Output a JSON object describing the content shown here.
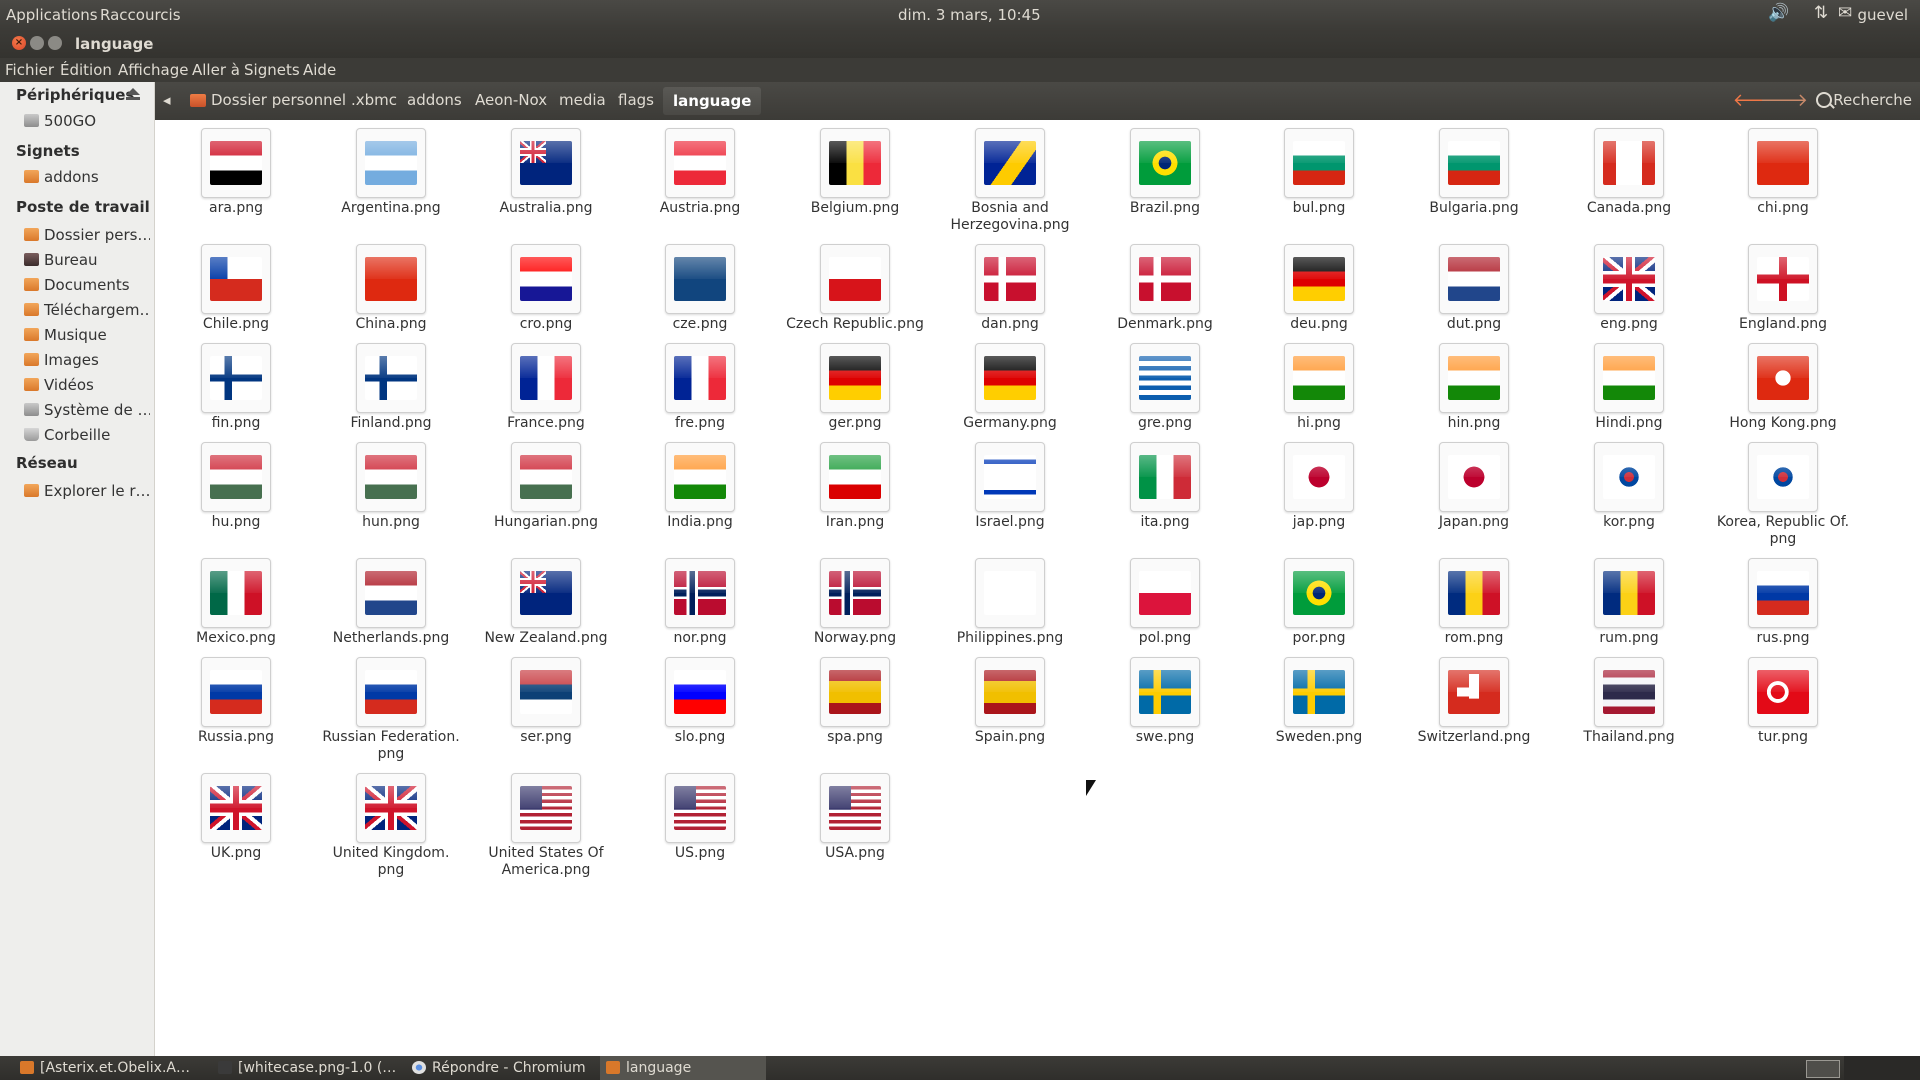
{
  "top_panel": {
    "apps": "Applications",
    "places": "Raccourcis",
    "clock": "dim.  3 mars, 10:45",
    "user": "guevel"
  },
  "window": {
    "title": "language"
  },
  "menu": [
    "Fichier",
    "Édition",
    "Affichage",
    "Aller à",
    "Signets",
    "Aide"
  ],
  "sidebar": {
    "devices_title": "Périphériques",
    "devices": [
      {
        "label": "500GO",
        "icon": "drive-icon"
      }
    ],
    "bookmarks_title": "Signets",
    "bookmarks": [
      {
        "label": "addons",
        "icon": "folder-icon"
      }
    ],
    "computer_title": "Poste de travail",
    "computer": [
      {
        "label": "Dossier pers…",
        "icon": "home-folder-icon"
      },
      {
        "label": "Bureau",
        "icon": "desktop-icon"
      },
      {
        "label": "Documents",
        "icon": "folder-icon"
      },
      {
        "label": "Téléchargem…",
        "icon": "download-folder-icon"
      },
      {
        "label": "Musique",
        "icon": "music-folder-icon"
      },
      {
        "label": "Images",
        "icon": "pictures-folder-icon"
      },
      {
        "label": "Vidéos",
        "icon": "videos-folder-icon"
      },
      {
        "label": "Système de …",
        "icon": "filesystem-icon"
      },
      {
        "label": "Corbeille",
        "icon": "trash-icon"
      }
    ],
    "network_title": "Réseau",
    "network": [
      {
        "label": "Explorer le r…",
        "icon": "network-icon"
      }
    ]
  },
  "breadcrumb": [
    "Dossier personnel",
    ".xbmc",
    "addons",
    "Aeon-Nox",
    "media",
    "flags"
  ],
  "breadcrumb_active": "language",
  "search_label": "Recherche",
  "files": [
    {
      "name": "ara.png",
      "name2": ""
    },
    {
      "name": "Argentina.png",
      "name2": ""
    },
    {
      "name": "Australia.png",
      "name2": ""
    },
    {
      "name": "Austria.png",
      "name2": ""
    },
    {
      "name": "Belgium.png",
      "name2": ""
    },
    {
      "name": "Bosnia and",
      "name2": "Herzegovina.png"
    },
    {
      "name": "Brazil.png",
      "name2": ""
    },
    {
      "name": "bul.png",
      "name2": ""
    },
    {
      "name": "Bulgaria.png",
      "name2": ""
    },
    {
      "name": "Canada.png",
      "name2": ""
    },
    {
      "name": "chi.png",
      "name2": ""
    },
    {
      "name": "Chile.png",
      "name2": ""
    },
    {
      "name": "China.png",
      "name2": ""
    },
    {
      "name": "cro.png",
      "name2": ""
    },
    {
      "name": "cze.png",
      "name2": ""
    },
    {
      "name": "Czech Republic.png",
      "name2": ""
    },
    {
      "name": "dan.png",
      "name2": ""
    },
    {
      "name": "Denmark.png",
      "name2": ""
    },
    {
      "name": "deu.png",
      "name2": ""
    },
    {
      "name": "dut.png",
      "name2": ""
    },
    {
      "name": "eng.png",
      "name2": ""
    },
    {
      "name": "England.png",
      "name2": ""
    },
    {
      "name": "fin.png",
      "name2": ""
    },
    {
      "name": "Finland.png",
      "name2": ""
    },
    {
      "name": "France.png",
      "name2": ""
    },
    {
      "name": "fre.png",
      "name2": ""
    },
    {
      "name": "ger.png",
      "name2": ""
    },
    {
      "name": "Germany.png",
      "name2": ""
    },
    {
      "name": "gre.png",
      "name2": ""
    },
    {
      "name": "hi.png",
      "name2": ""
    },
    {
      "name": "hin.png",
      "name2": ""
    },
    {
      "name": "Hindi.png",
      "name2": ""
    },
    {
      "name": "Hong Kong.png",
      "name2": ""
    },
    {
      "name": "hu.png",
      "name2": ""
    },
    {
      "name": "hun.png",
      "name2": ""
    },
    {
      "name": "Hungarian.png",
      "name2": ""
    },
    {
      "name": "India.png",
      "name2": ""
    },
    {
      "name": "Iran.png",
      "name2": ""
    },
    {
      "name": "Israel.png",
      "name2": ""
    },
    {
      "name": "ita.png",
      "name2": ""
    },
    {
      "name": "jap.png",
      "name2": ""
    },
    {
      "name": "Japan.png",
      "name2": ""
    },
    {
      "name": "kor.png",
      "name2": ""
    },
    {
      "name": "Korea, Republic Of.",
      "name2": "png"
    },
    {
      "name": "Mexico.png",
      "name2": ""
    },
    {
      "name": "Netherlands.png",
      "name2": ""
    },
    {
      "name": "New Zealand.png",
      "name2": ""
    },
    {
      "name": "nor.png",
      "name2": ""
    },
    {
      "name": "Norway.png",
      "name2": ""
    },
    {
      "name": "Philippines.png",
      "name2": ""
    },
    {
      "name": "pol.png",
      "name2": ""
    },
    {
      "name": "por.png",
      "name2": ""
    },
    {
      "name": "rom.png",
      "name2": ""
    },
    {
      "name": "rum.png",
      "name2": ""
    },
    {
      "name": "rus.png",
      "name2": ""
    },
    {
      "name": "Russia.png",
      "name2": ""
    },
    {
      "name": "Russian Federation.",
      "name2": "png"
    },
    {
      "name": "ser.png",
      "name2": ""
    },
    {
      "name": "slo.png",
      "name2": ""
    },
    {
      "name": "spa.png",
      "name2": ""
    },
    {
      "name": "Spain.png",
      "name2": ""
    },
    {
      "name": "swe.png",
      "name2": ""
    },
    {
      "name": "Sweden.png",
      "name2": ""
    },
    {
      "name": "Switzerland.png",
      "name2": ""
    },
    {
      "name": "Thailand.png",
      "name2": ""
    },
    {
      "name": "tur.png",
      "name2": ""
    },
    {
      "name": "UK.png",
      "name2": ""
    },
    {
      "name": "United Kingdom.",
      "name2": "png"
    },
    {
      "name": "United States Of",
      "name2": "America.png"
    },
    {
      "name": "US.png",
      "name2": ""
    },
    {
      "name": "USA.png",
      "name2": ""
    }
  ],
  "taskbar": [
    {
      "label": "[Asterix.et.Obelix.A…",
      "icon": "folder-icon"
    },
    {
      "label": "[whitecase.png-1.0 (…",
      "icon": "image-viewer-icon"
    },
    {
      "label": "Répondre - Chromium",
      "icon": "chromium-icon"
    },
    {
      "label": "language",
      "icon": "folder-icon"
    }
  ]
}
